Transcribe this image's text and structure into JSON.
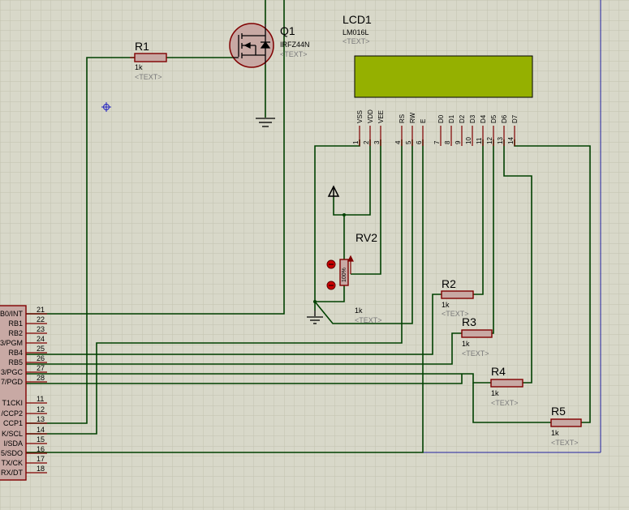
{
  "colors": {
    "background": "#d8d8c9",
    "grid": "#c2c2b0",
    "wire": "#004000",
    "component": "#800000",
    "resistor_fill": "#c8a9a4",
    "lcd_screen": "#95b000",
    "sheet_border": "#2020a0"
  },
  "icons": {
    "mosfet": "mosfet-symbol",
    "ground": "ground-symbol",
    "power": "power-terminal-symbol",
    "potentiometer": "potentiometer-symbol",
    "origin_marker": "crosshair-icon"
  },
  "q1": {
    "ref": "Q1",
    "part": "IRFZ44N",
    "text": "<TEXT>"
  },
  "lcd": {
    "ref": "LCD1",
    "part": "LM016L",
    "text": "<TEXT>",
    "pins": [
      {
        "name": "VSS",
        "num": "1"
      },
      {
        "name": "VDD",
        "num": "2"
      },
      {
        "name": "VEE",
        "num": "3"
      },
      {
        "name": "RS",
        "num": "4"
      },
      {
        "name": "RW",
        "num": "5"
      },
      {
        "name": "E",
        "num": "6"
      },
      {
        "name": "D0",
        "num": "7"
      },
      {
        "name": "D1",
        "num": "8"
      },
      {
        "name": "D2",
        "num": "9"
      },
      {
        "name": "D3",
        "num": "10"
      },
      {
        "name": "D4",
        "num": "11"
      },
      {
        "name": "D5",
        "num": "12"
      },
      {
        "name": "D6",
        "num": "13"
      },
      {
        "name": "D7",
        "num": "14"
      }
    ]
  },
  "r1": {
    "ref": "R1",
    "value": "1k",
    "text": "<TEXT>"
  },
  "r2": {
    "ref": "R2",
    "value": "1k",
    "text": "<TEXT>"
  },
  "r3": {
    "ref": "R3",
    "value": "1k",
    "text": "<TEXT>"
  },
  "r4": {
    "ref": "R4",
    "value": "1k",
    "text": "<TEXT>"
  },
  "r5": {
    "ref": "R5",
    "value": "1k",
    "text": "<TEXT>"
  },
  "rv2": {
    "ref": "RV2",
    "value": "1k",
    "text": "<TEXT>",
    "percent": "100%"
  },
  "mcu": {
    "pins": [
      {
        "name": "B0/INT",
        "num": "21"
      },
      {
        "name": "RB1",
        "num": "22"
      },
      {
        "name": "RB2",
        "num": "23"
      },
      {
        "name": "3/PGM",
        "num": "24"
      },
      {
        "name": "RB4",
        "num": "25"
      },
      {
        "name": "RB5",
        "num": "26"
      },
      {
        "name": "3/PGC",
        "num": "27"
      },
      {
        "name": "7/PGD",
        "num": "28"
      },
      {
        "name": "T1CKI",
        "num": "11"
      },
      {
        "name": "/CCP2",
        "num": "12"
      },
      {
        "name": "CCP1",
        "num": "13"
      },
      {
        "name": "K/SCL",
        "num": "14"
      },
      {
        "name": "I/SDA",
        "num": "15"
      },
      {
        "name": "5/SDO",
        "num": "16"
      },
      {
        "name": "TX/CK",
        "num": "17"
      },
      {
        "name": "RX/DT",
        "num": "18"
      }
    ]
  }
}
